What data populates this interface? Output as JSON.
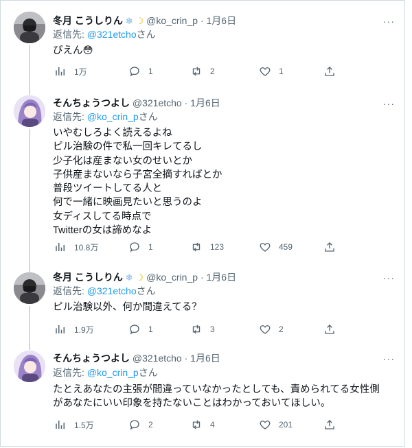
{
  "tweets": [
    {
      "name": "冬月 こうしりん",
      "handle": "@ko_crin_p",
      "date": "1月6日",
      "reply_prefix": "返信先: ",
      "reply_to": "@321etcho",
      "reply_suffix": "さん",
      "lines": [
        "ぴえん😳"
      ],
      "views": "1万",
      "replies": "1",
      "retweets": "2",
      "likes": "1"
    },
    {
      "name": "そんちょうつよし",
      "handle": "@321etcho",
      "date": "1月6日",
      "reply_prefix": "返信先: ",
      "reply_to": "@ko_crin_p",
      "reply_suffix": "さん",
      "lines": [
        "いやむしろよく読えるよね",
        "ピル治験の件で私一回キレてるし",
        "少子化は産まない女のせいとか",
        "子供産まないなら子宮全摘すればとか",
        "普段ツイートしてる人と",
        "何で一緒に映画見たいと思うのよ",
        "女ディスしてる時点で",
        "Twitterの女は諦めなよ"
      ],
      "views": "10.8万",
      "replies": "1",
      "retweets": "123",
      "likes": "459"
    },
    {
      "name": "冬月 こうしりん",
      "handle": "@ko_crin_p",
      "date": "1月6日",
      "reply_prefix": "返信先: ",
      "reply_to": "@321etcho",
      "reply_suffix": "さん",
      "lines": [
        "ピル治験以外、何か間違えてる？"
      ],
      "views": "1.9万",
      "replies": "1",
      "retweets": "3",
      "likes": "2"
    },
    {
      "name": "そんちょうつよし",
      "handle": "@321etcho",
      "date": "1月6日",
      "reply_prefix": "返信先: ",
      "reply_to": "@ko_crin_p",
      "reply_suffix": "さん",
      "lines": [
        "たとえあなたの主張が間違っていなかったとしても、責められてる女性側",
        "があなたにいい印象を持たないことはわかっておいてほしい。"
      ],
      "views": "1.5万",
      "replies": "2",
      "retweets": "4",
      "likes": "201"
    }
  ],
  "icons": {
    "snowflake": "❄",
    "moon": "☽",
    "more": "···"
  },
  "colors": {
    "link": "#1d9bf0",
    "secondary": "#536471",
    "text": "#0f1419",
    "border": "#cfd9de"
  }
}
